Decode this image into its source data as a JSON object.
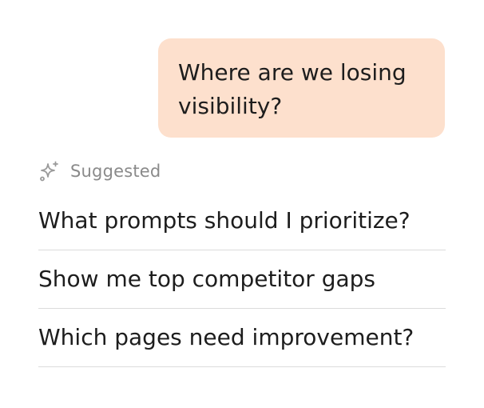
{
  "conversation": {
    "user_message": "Where are we losing visibility?"
  },
  "suggestions": {
    "header_label": "Suggested",
    "header_icon": "sparkle-icon",
    "items": [
      {
        "label": "What prompts should I prioritize?"
      },
      {
        "label": "Show me top competitor gaps"
      },
      {
        "label": "Which pages need improvement?"
      }
    ]
  },
  "colors": {
    "user_bubble_bg": "#fde0cd",
    "muted_text": "#8a8a8a",
    "divider": "#dcdcdc",
    "text": "#1d1d1d"
  }
}
